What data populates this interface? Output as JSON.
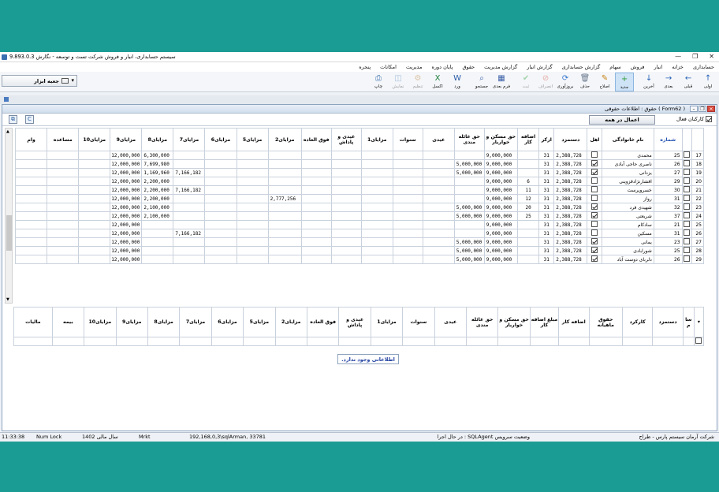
{
  "window": {
    "title": "سیستم حسابداری، انبار و فروش شرکت تست و توسعه - نگارش 9.893.0.3",
    "controls": [
      "—",
      "❐",
      "✕"
    ]
  },
  "menu": [
    "حسابداری",
    "خزانه",
    "انبار",
    "فروش",
    "سهام",
    "گزارش حسابداری",
    "گزارش انبار",
    "گزارش مدیریت",
    "حقوق",
    "پایان دوره",
    "مدیریت",
    "امکانات",
    "پنجره"
  ],
  "toolbar": {
    "buttons": [
      {
        "label": "اولی",
        "icon": "↑",
        "color": "#2a62b8"
      },
      {
        "label": "قبلی",
        "icon": "←",
        "color": "#2a62b8"
      },
      {
        "label": "بعدی",
        "icon": "→",
        "color": "#2a62b8"
      },
      {
        "label": "آخرین",
        "icon": "↓",
        "color": "#2a62b8"
      },
      {
        "label": "جدید",
        "icon": "+",
        "color": "#2f9e3a"
      },
      {
        "label": "اصلاح",
        "icon": "✎",
        "color": "#c8861a"
      },
      {
        "label": "حذف",
        "icon": "🗑",
        "color": "#6b7a8f"
      },
      {
        "label": "بروزآوری",
        "icon": "⟳",
        "color": "#3a7ad1"
      },
      {
        "label": "انصراف",
        "icon": "⊘",
        "color": "#d23b2f"
      },
      {
        "label": "ثبت",
        "icon": "✔",
        "color": "#2f9e3a"
      },
      {
        "label": "فرم بعدی",
        "icon": "▦",
        "color": "#3a5fa8"
      },
      {
        "label": "جستجو",
        "icon": "⌕",
        "color": "#3a5fa8"
      },
      {
        "label": "ورد",
        "icon": "W",
        "color": "#2a5caa"
      },
      {
        "label": "اکسل",
        "icon": "X",
        "color": "#1e7e3c"
      },
      {
        "label": "تنظیم",
        "icon": "⚙",
        "color": "#b87b2a"
      },
      {
        "label": "نمایش",
        "icon": "◫",
        "color": "#3a6fb0"
      },
      {
        "label": "چاپ",
        "icon": "⎙",
        "color": "#3a6fb0"
      }
    ],
    "toolbox_label": "جعبه ابزار"
  },
  "form": {
    "title": "حقوق : اطلاعات حقوقی ( Form62 )",
    "all_employees_label": "کارکنان فعال",
    "apply_all_label": "اعمال در همه"
  },
  "grid1": {
    "columns": [
      "شماره",
      "نام خانوادگی",
      "اهل",
      "دستمزد",
      "ارکر",
      "اضافه کار",
      "حق مسکن و خواربار",
      "حق عائله مندی",
      "عیدی",
      "سنوات",
      "مزایای1",
      "عیدی و پاداش",
      "فوق العاده",
      "مزایای2",
      "مزایای5",
      "مزایای6",
      "مزایای7",
      "مزایای8",
      "مزایای9",
      "مزایای10",
      "مساعده",
      "وام"
    ],
    "rows": [
      {
        "no": "17",
        "code": "25",
        "name": "محمدی",
        "ahl": false,
        "wage": "2,388,728",
        "days": "31",
        "ot": "",
        "housing": "9,000,000",
        "family": "",
        "m1": "",
        "m2": "",
        "m7": "",
        "m8": "6,300,000",
        "m9": "12,000,000"
      },
      {
        "no": "18",
        "code": "26",
        "name": "ناصری حاجی آبادی",
        "ahl": true,
        "wage": "2,388,728",
        "days": "31",
        "ot": "",
        "housing": "9,000,000",
        "family": "5,000,000",
        "m1": "",
        "m2": "",
        "m7": "",
        "m8": "7,699,980",
        "m9": "12,000,000"
      },
      {
        "no": "19",
        "code": "27",
        "name": "یزدانی",
        "ahl": true,
        "wage": "2,388,728",
        "days": "31",
        "ot": "",
        "housing": "9,000,000",
        "family": "5,000,000",
        "m1": "",
        "m2": "",
        "m7": "7,166,182",
        "m8": "1,169,960",
        "m9": "12,000,000"
      },
      {
        "no": "20",
        "code": "29",
        "name": "افشارنژادقزوینی",
        "ahl": false,
        "wage": "2,388,728",
        "days": "31",
        "ot": "6",
        "housing": "9,000,000",
        "family": "",
        "m1": "",
        "m2": "",
        "m7": "",
        "m8": "2,200,000",
        "m9": "12,000,000"
      },
      {
        "no": "21",
        "code": "30",
        "name": "خسروپرست",
        "ahl": false,
        "wage": "2,388,728",
        "days": "31",
        "ot": "11",
        "housing": "9,000,000",
        "family": "",
        "m1": "",
        "m2": "",
        "m7": "7,166,182",
        "m8": "2,200,000",
        "m9": "12,000,000"
      },
      {
        "no": "22",
        "code": "31",
        "name": "رواز",
        "ahl": false,
        "wage": "2,388,728",
        "days": "31",
        "ot": "12",
        "housing": "9,000,000",
        "family": "",
        "m1": "",
        "m2": "2,777,256",
        "m7": "",
        "m8": "2,200,000",
        "m9": "12,000,000"
      },
      {
        "no": "23",
        "code": "32",
        "name": "شهیدی فرد",
        "ahl": true,
        "wage": "2,388,728",
        "days": "31",
        "ot": "20",
        "housing": "9,000,000",
        "family": "5,000,000",
        "m1": "",
        "m2": "",
        "m7": "",
        "m8": "2,100,000",
        "m9": "12,000,000"
      },
      {
        "no": "24",
        "code": "37",
        "name": "شریعتی",
        "ahl": true,
        "wage": "2,388,728",
        "days": "31",
        "ot": "25",
        "housing": "9,000,000",
        "family": "5,000,000",
        "m1": "",
        "m2": "",
        "m7": "",
        "m8": "2,100,000",
        "m9": "12,000,000"
      },
      {
        "no": "25",
        "code": "21",
        "name": "سادکام",
        "ahl": false,
        "wage": "2,388,728",
        "days": "31",
        "ot": "",
        "housing": "9,000,000",
        "family": "",
        "m1": "",
        "m2": "",
        "m7": "",
        "m8": "",
        "m9": "12,000,000"
      },
      {
        "no": "26",
        "code": "31",
        "name": "مسکین",
        "ahl": false,
        "wage": "2,388,728",
        "days": "31",
        "ot": "",
        "housing": "9,000,000",
        "family": "",
        "m1": "",
        "m2": "",
        "m7": "7,166,182",
        "m8": "",
        "m9": "12,000,000"
      },
      {
        "no": "27",
        "code": "23",
        "name": "یمانی",
        "ahl": true,
        "wage": "2,388,728",
        "days": "31",
        "ot": "",
        "housing": "9,000,000",
        "family": "5,000,000",
        "m1": "",
        "m2": "",
        "m7": "",
        "m8": "",
        "m9": "12,000,000"
      },
      {
        "no": "28",
        "code": "25",
        "name": "شورابادی",
        "ahl": true,
        "wage": "2,388,728",
        "days": "31",
        "ot": "",
        "housing": "9,000,000",
        "family": "5,000,000",
        "m1": "",
        "m2": "",
        "m7": "",
        "m8": "",
        "m9": "12,000,000"
      },
      {
        "no": "29",
        "code": "26",
        "name": "دلربای دوست آباد",
        "ahl": true,
        "wage": "2,388,728",
        "days": "31",
        "ot": "",
        "housing": "9,000,000",
        "family": "5,000,000",
        "m1": "",
        "m2": "",
        "m7": "",
        "m8": "",
        "m9": "12,000,000"
      }
    ]
  },
  "grid2": {
    "columns": [
      "سا م",
      "دستمزد",
      "کارکرد",
      "حقوق ماهیانه",
      "اضافه کار",
      "مبلغ اضافه کار",
      "حق مسکن و خواربار",
      "حق عائله مندی",
      "عیدی",
      "سنوات",
      "مزایای1",
      "عیدی و پاداش",
      "فوق العاده",
      "مزایای2",
      "مزایای5",
      "مزایای6",
      "مزایای7",
      "مزایای8",
      "مزایای9",
      "مزایای10",
      "بیمه",
      "مالیات"
    ],
    "empty_message": "اطلاعاتی وجود ندارد."
  },
  "status": {
    "company": "شرکت آرمان سیستم پارس - طراح",
    "service": "در حال اجرا : SQLAgent وضعیت سرویس",
    "server": "192,168,0,3\\sqlArman, 33781",
    "mode": "Mrkt",
    "fiscal_year": "سال مالی 1402",
    "numlock": "Num Lock",
    "time": "11:33:38"
  }
}
